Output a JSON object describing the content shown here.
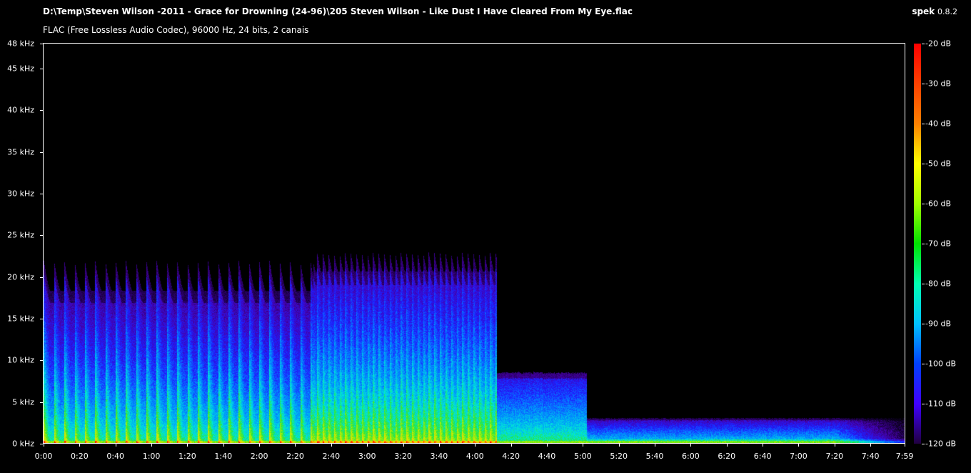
{
  "header": {
    "file_path": "D:\\Temp\\Steven Wilson -2011 - Grace for Drowning (24-96)\\205 Steven Wilson - Like Dust I Have Cleared From My Eye.flac",
    "stream_info": "FLAC (Free Lossless Audio Codec), 96000 Hz, 24 bits, 2 canais",
    "app_name": "spek",
    "app_version": "0.8.2"
  },
  "chart_data": {
    "type": "heatmap",
    "y_axis": {
      "unit": "kHz",
      "ylim": [
        0,
        48
      ],
      "ticks": [
        {
          "value": 0,
          "label": "0 kHz"
        },
        {
          "value": 5,
          "label": "5 kHz"
        },
        {
          "value": 10,
          "label": "10 kHz"
        },
        {
          "value": 15,
          "label": "15 kHz"
        },
        {
          "value": 20,
          "label": "20 kHz"
        },
        {
          "value": 25,
          "label": "25 kHz"
        },
        {
          "value": 30,
          "label": "30 kHz"
        },
        {
          "value": 35,
          "label": "35 kHz"
        },
        {
          "value": 40,
          "label": "40 kHz"
        },
        {
          "value": 45,
          "label": "45 kHz"
        },
        {
          "value": 48,
          "label": "48 kHz"
        }
      ]
    },
    "x_axis": {
      "unit": "seconds",
      "xlim": [
        0,
        479
      ],
      "ticks": [
        {
          "value": 0,
          "label": "0:00"
        },
        {
          "value": 20,
          "label": "0:20"
        },
        {
          "value": 40,
          "label": "0:40"
        },
        {
          "value": 60,
          "label": "1:00"
        },
        {
          "value": 80,
          "label": "1:20"
        },
        {
          "value": 100,
          "label": "1:40"
        },
        {
          "value": 120,
          "label": "2:00"
        },
        {
          "value": 140,
          "label": "2:20"
        },
        {
          "value": 160,
          "label": "2:40"
        },
        {
          "value": 180,
          "label": "3:00"
        },
        {
          "value": 200,
          "label": "3:20"
        },
        {
          "value": 220,
          "label": "3:40"
        },
        {
          "value": 240,
          "label": "4:00"
        },
        {
          "value": 260,
          "label": "4:20"
        },
        {
          "value": 280,
          "label": "4:40"
        },
        {
          "value": 300,
          "label": "5:00"
        },
        {
          "value": 320,
          "label": "5:20"
        },
        {
          "value": 340,
          "label": "5:40"
        },
        {
          "value": 360,
          "label": "6:00"
        },
        {
          "value": 380,
          "label": "6:20"
        },
        {
          "value": 400,
          "label": "6:40"
        },
        {
          "value": 420,
          "label": "7:00"
        },
        {
          "value": 440,
          "label": "7:20"
        },
        {
          "value": 460,
          "label": "7:40"
        },
        {
          "value": 479,
          "label": "7:59"
        }
      ]
    },
    "colorbar": {
      "unit": "dB",
      "range": [
        -120,
        -20
      ],
      "ticks": [
        "-20 dB",
        "-30 dB",
        "-40 dB",
        "-50 dB",
        "-60 dB",
        "-70 dB",
        "-80 dB",
        "-90 dB",
        "-100 dB",
        "-110 dB",
        "-120 dB"
      ]
    },
    "segments": [
      {
        "start_s": 0,
        "end_s": 150,
        "max_freq_khz": 22,
        "character": "pulsed"
      },
      {
        "start_s": 150,
        "end_s": 252,
        "max_freq_khz": 23,
        "character": "dense"
      },
      {
        "start_s": 252,
        "end_s": 302,
        "max_freq_khz": 9.5,
        "character": "mid"
      },
      {
        "start_s": 302,
        "end_s": 479,
        "max_freq_khz": 3.5,
        "character": "low"
      }
    ]
  }
}
